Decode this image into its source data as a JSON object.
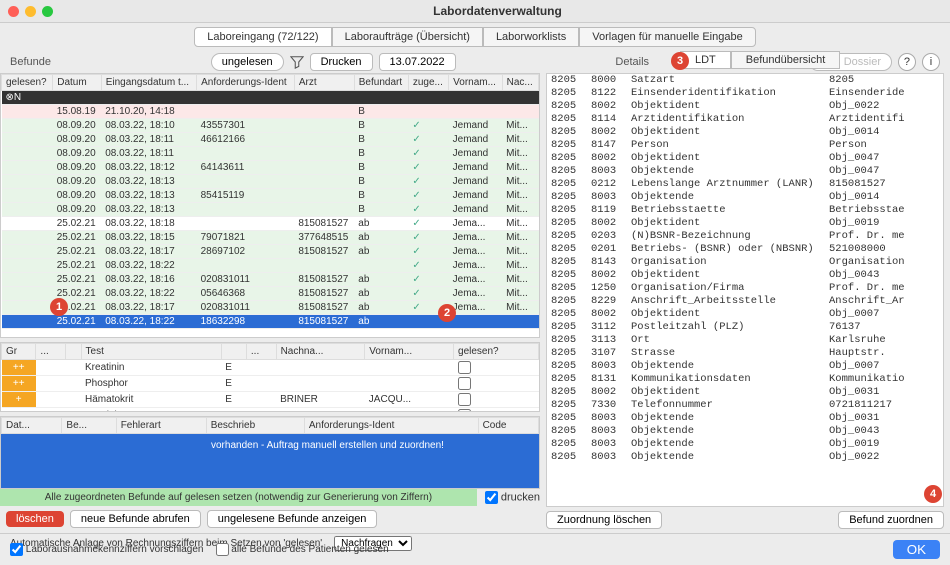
{
  "window": {
    "title": "Labordatenverwaltung"
  },
  "mainTabs": [
    {
      "label": "Laboreingang (72/122)",
      "active": true
    },
    {
      "label": "Laboraufträge (Übersicht)"
    },
    {
      "label": "Laborworklists"
    },
    {
      "label": "Vorlagen für manuelle Eingabe"
    }
  ],
  "toolbar": {
    "befunde": "Befunde",
    "ungelesen": "ungelesen",
    "drucken": "Drucken",
    "date": "13.07.2022",
    "zumDossier": "zum Dossier"
  },
  "topTable": {
    "cols": [
      "gelesen?",
      "Datum",
      "Eingangsdatum t...",
      "Anforderungs-Ident",
      "Arzt",
      "Befundart",
      "zuge...",
      "Vornam...",
      "Nac..."
    ],
    "rows": [
      {
        "cls": "row-dark",
        "c": [
          "⊗N",
          "",
          "",
          "",
          "",
          "",
          "",
          "",
          ""
        ]
      },
      {
        "cls": "row-pink",
        "c": [
          "",
          "15.08.19",
          "21.10.20, 14:18",
          "",
          "",
          "B",
          "",
          "",
          ""
        ]
      },
      {
        "cls": "row-alt",
        "c": [
          "",
          "08.09.20",
          "08.03.22, 18:10",
          "43557301",
          "",
          "B",
          "✓",
          "Jemand",
          "Mit..."
        ]
      },
      {
        "cls": "row-alt",
        "c": [
          "",
          "08.09.20",
          "08.03.22, 18:11",
          "46612166",
          "",
          "B",
          "✓",
          "Jemand",
          "Mit..."
        ]
      },
      {
        "cls": "row-alt",
        "c": [
          "",
          "08.09.20",
          "08.03.22, 18:11",
          "",
          "",
          "B",
          "✓",
          "Jemand",
          "Mit..."
        ]
      },
      {
        "cls": "row-alt",
        "c": [
          "",
          "08.09.20",
          "08.03.22, 18:12",
          "64143611",
          "",
          "B",
          "✓",
          "Jemand",
          "Mit..."
        ]
      },
      {
        "cls": "row-alt",
        "c": [
          "",
          "08.09.20",
          "08.03.22, 18:13",
          "",
          "",
          "B",
          "✓",
          "Jemand",
          "Mit..."
        ]
      },
      {
        "cls": "row-alt",
        "c": [
          "",
          "08.09.20",
          "08.03.22, 18:13",
          "85415119",
          "",
          "B",
          "✓",
          "Jemand",
          "Mit..."
        ]
      },
      {
        "cls": "row-alt",
        "c": [
          "",
          "08.09.20",
          "08.03.22, 18:13",
          "",
          "",
          "B",
          "✓",
          "Jemand",
          "Mit..."
        ]
      },
      {
        "cls": "",
        "c": [
          "",
          "25.02.21",
          "08.03.22, 18:18",
          "",
          "815081527",
          "ab",
          "✓",
          "Jema...",
          "Mit..."
        ]
      },
      {
        "cls": "row-alt",
        "c": [
          "",
          "25.02.21",
          "08.03.22, 18:15",
          "79071821",
          "377648515",
          "ab",
          "✓",
          "Jema...",
          "Mit..."
        ]
      },
      {
        "cls": "row-alt",
        "c": [
          "",
          "25.02.21",
          "08.03.22, 18:17",
          "28697102",
          "815081527",
          "ab",
          "✓",
          "Jema...",
          "Mit..."
        ]
      },
      {
        "cls": "row-alt",
        "c": [
          "",
          "25.02.21",
          "08.03.22, 18:22",
          "",
          "",
          "",
          "✓",
          "Jema...",
          "Mit..."
        ]
      },
      {
        "cls": "row-alt",
        "c": [
          "",
          "25.02.21",
          "08.03.22, 18:16",
          "020831011",
          "815081527",
          "ab",
          "✓",
          "Jema...",
          "Mit..."
        ]
      },
      {
        "cls": "row-alt",
        "c": [
          "",
          "25.02.21",
          "08.03.22, 18:22",
          "05646368",
          "815081527",
          "ab",
          "✓",
          "Jema...",
          "Mit..."
        ]
      },
      {
        "cls": "row-alt",
        "c": [
          "",
          "25.02.21",
          "08.03.22, 18:17",
          "020831011",
          "815081527",
          "ab",
          "✓",
          "Jema...",
          "Mit..."
        ]
      },
      {
        "cls": "row-sel",
        "c": [
          "",
          "25.02.21",
          "08.03.22, 18:22",
          "18632298",
          "815081527",
          "ab",
          "",
          "",
          ""
        ]
      }
    ]
  },
  "subTable": {
    "cols": [
      "Gr",
      "...",
      "",
      "Test",
      "",
      "...",
      "Nachna...",
      "Vornam...",
      "gelesen?"
    ],
    "rows": [
      {
        "flag": "++",
        "test": "Kreatinin",
        "e": "E",
        "nach": "",
        "vor": ""
      },
      {
        "flag": "++",
        "test": "Phosphor",
        "e": "E",
        "nach": "",
        "vor": ""
      },
      {
        "flag": "+",
        "test": "Hämatokrit",
        "e": "E",
        "nach": "BRINER",
        "vor": "JACQU..."
      },
      {
        "flag": "",
        "test": "-Reaktives Prote",
        "e": "E",
        "nach": "",
        "vor": ""
      }
    ]
  },
  "errTable": {
    "cols": [
      "Dat...",
      "Be...",
      "Fehlerart",
      "Beschrieb",
      "Anforderungs-Ident",
      "Code"
    ],
    "msg": "vorhanden - Auftrag manuell erstellen und zuordnen!"
  },
  "greenbar": "Alle zugeordneten Befunde auf gelesen setzen (notwendig zur Generierung von Ziffern)",
  "printChk": "drucken",
  "actions": {
    "loeschen": "löschen",
    "neueBefunde": "neue Befunde abrufen",
    "ungeleseneBefunde": "ungelesene Befunde anzeigen"
  },
  "autoLine": {
    "text": "Automatische Anlage von Rechnungsziffern beim Setzen von 'gelesen'",
    "sel": "Nachfragen"
  },
  "footer": {
    "chk1": "Laborausnahmekennziffern vorschlagen",
    "chk2": "alle Befunde des Patienten gelesen",
    "ok": "OK"
  },
  "details": {
    "label": "Details",
    "tabs": [
      {
        "label": "LDT",
        "active": true
      },
      {
        "label": "Befundübersicht"
      }
    ],
    "zuordLoeschen": "Zuordnung löschen",
    "befundZuordnen": "Befund zuordnen",
    "rows": [
      [
        "8205",
        "8000",
        "Satzart",
        "8205"
      ],
      [
        "8205",
        "8122",
        "Einsenderidentifikation",
        "Einsenderide"
      ],
      [
        "8205",
        "8002",
        "Objektident",
        "Obj_0022"
      ],
      [
        "8205",
        "8114",
        "Arztidentifikation",
        "Arztidentifi"
      ],
      [
        "8205",
        "8002",
        "Objektident",
        "Obj_0014"
      ],
      [
        "8205",
        "8147",
        "Person",
        "Person"
      ],
      [
        "8205",
        "8002",
        "Objektident",
        "Obj_0047"
      ],
      [
        "8205",
        "8003",
        "Objektende",
        "Obj_0047"
      ],
      [
        "8205",
        "0212",
        "Lebenslange Arztnummer (LANR)",
        "815081527"
      ],
      [
        "8205",
        "8003",
        "Objektende",
        "Obj_0014"
      ],
      [
        "8205",
        "8119",
        "Betriebsstaette",
        "Betriebsstae"
      ],
      [
        "8205",
        "8002",
        "Objektident",
        "Obj_0019"
      ],
      [
        "8205",
        "0203",
        "(N)BSNR-Bezeichnung",
        "Prof. Dr. me"
      ],
      [
        "8205",
        "0201",
        "Betriebs- (BSNR) oder (NBSNR)",
        "521008000"
      ],
      [
        "8205",
        "8143",
        "Organisation",
        "Organisation"
      ],
      [
        "8205",
        "8002",
        "Objektident",
        "Obj_0043"
      ],
      [
        "8205",
        "1250",
        "Organisation/Firma",
        "Prof. Dr. me"
      ],
      [
        "8205",
        "8229",
        "Anschrift_Arbeitsstelle",
        "Anschrift_Ar"
      ],
      [
        "8205",
        "8002",
        "Objektident",
        "Obj_0007"
      ],
      [
        "8205",
        "3112",
        "Postleitzahl (PLZ)",
        "76137"
      ],
      [
        "8205",
        "3113",
        "Ort",
        "Karlsruhe"
      ],
      [
        "8205",
        "3107",
        "Strasse",
        "Hauptstr."
      ],
      [
        "8205",
        "8003",
        "Objektende",
        "Obj_0007"
      ],
      [
        "8205",
        "8131",
        "Kommunikationsdaten",
        "Kommunikatio"
      ],
      [
        "8205",
        "8002",
        "Objektident",
        "Obj_0031"
      ],
      [
        "8205",
        "7330",
        "Telefonnummer",
        "0721811217"
      ],
      [
        "8205",
        "8003",
        "Objektende",
        "Obj_0031"
      ],
      [
        "8205",
        "8003",
        "Objektende",
        "Obj_0043"
      ],
      [
        "8205",
        "8003",
        "Objektende",
        "Obj_0019"
      ],
      [
        "8205",
        "8003",
        "Objektende",
        "Obj_0022"
      ]
    ]
  },
  "markers": {
    "m1": "1",
    "m2": "2",
    "m3": "3",
    "m4": "4"
  }
}
